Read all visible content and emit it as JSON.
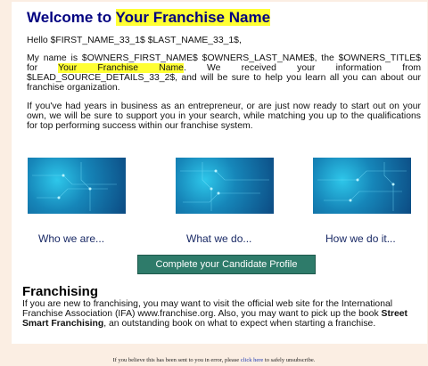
{
  "header": {
    "title_prefix": "Welcome to ",
    "title_highlight": "Your Franchise Name"
  },
  "body": {
    "greeting": "Hello $FIRST_NAME_33_1$ $LAST_NAME_33_1$,",
    "para2_before": "My name is $OWNERS_FIRST_NAME$ $OWNERS_LAST_NAME$, the $OWNERS_TITLE$ for ",
    "para2_highlight": "Your Franchise Name",
    "para2_after": ". We received your information from $LEAD_SOURCE_DETAILS_33_2$, and will be sure to help you learn all you can about our franchise organization.",
    "para3": "If you've had years in business as an entrepreneur, or are just now ready to start out on your own, we will be sure to support you in your search, while matching you up to the qualifications for top performing success within our franchise system."
  },
  "features": {
    "items": [
      {
        "label": "Who we are..."
      },
      {
        "label": "What we do..."
      },
      {
        "label": "How we do it..."
      }
    ]
  },
  "cta": {
    "label": "Complete your Candidate Profile"
  },
  "franchising": {
    "title": "Franchising",
    "text_before": "If you are new to franchising, you may want to visit the official web site for the International Franchise Association (IFA) www.franchise.org.   Also, you may want to pick up the book ",
    "book": "Street Smart Franchising",
    "text_after": ", an outstanding book on what to expect when starting a franchise."
  },
  "footer": {
    "before": "If you believe this has been sent to you in error, please ",
    "link": "click here",
    "after": " to safely unsubscribe."
  },
  "colors": {
    "title": "#000080",
    "highlight": "#ffff33",
    "cta_bg": "#2e7b6a",
    "page_bg": "#fbeee3"
  }
}
